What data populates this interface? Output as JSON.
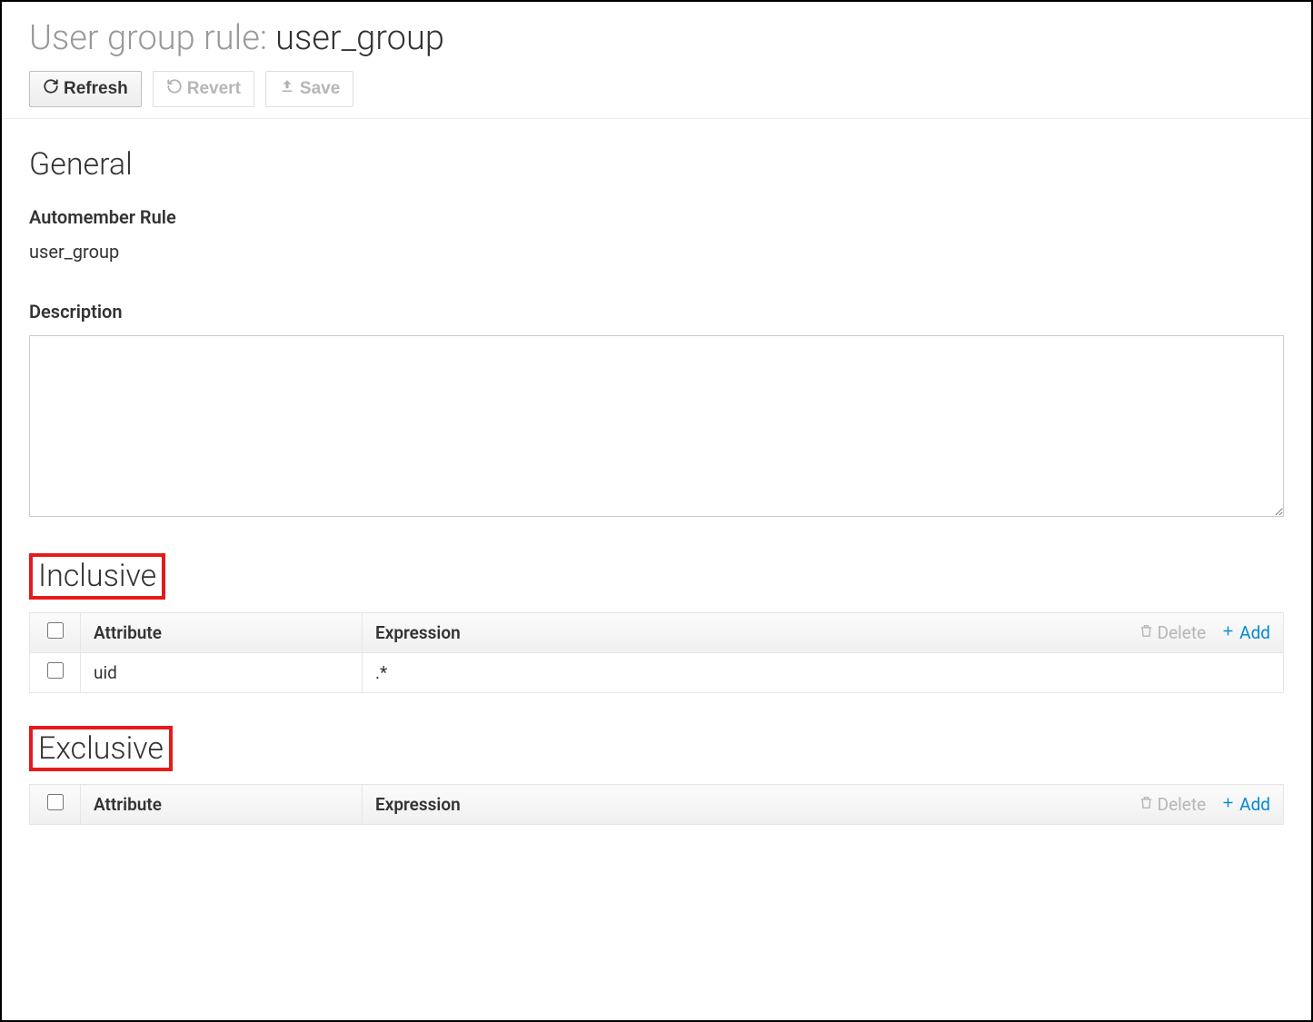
{
  "header": {
    "title_prefix": "User group rule: ",
    "title_value": "user_group"
  },
  "toolbar": {
    "refresh": "Refresh",
    "revert": "Revert",
    "save": "Save"
  },
  "general": {
    "heading": "General",
    "automember_label": "Automember Rule",
    "automember_value": "user_group",
    "description_label": "Description",
    "description_value": ""
  },
  "inclusive": {
    "heading": "Inclusive",
    "columns": {
      "attribute": "Attribute",
      "expression": "Expression"
    },
    "actions": {
      "delete": "Delete",
      "add": "Add"
    },
    "rows": [
      {
        "attribute": "uid",
        "expression": ".*"
      }
    ]
  },
  "exclusive": {
    "heading": "Exclusive",
    "columns": {
      "attribute": "Attribute",
      "expression": "Expression"
    },
    "actions": {
      "delete": "Delete",
      "add": "Add"
    },
    "rows": []
  }
}
